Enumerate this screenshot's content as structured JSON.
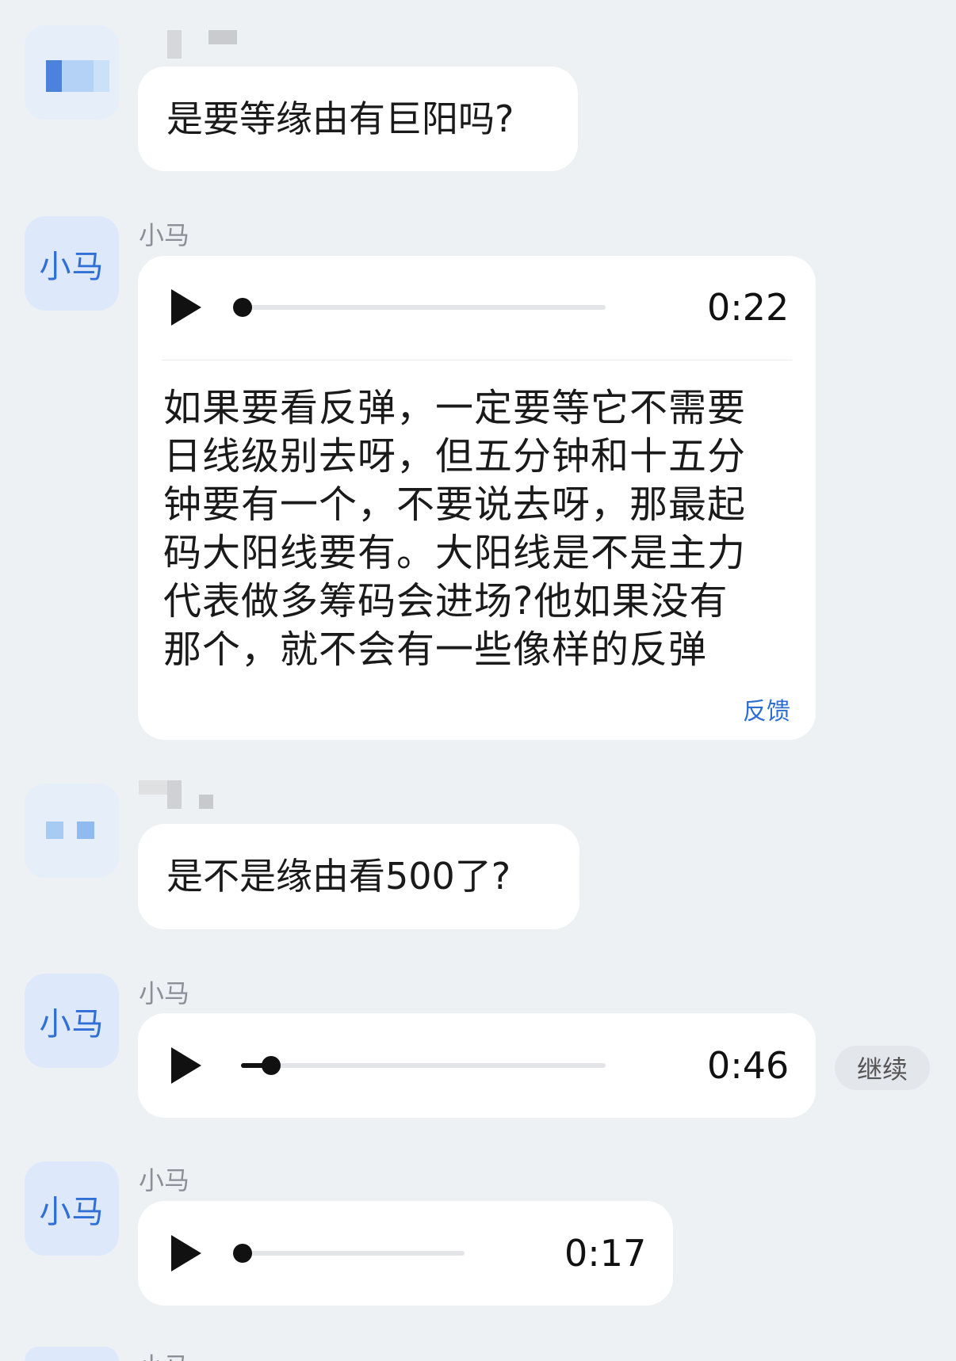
{
  "colors": {
    "background": "#eef1f4",
    "bubble": "#ffffff",
    "avatar_bg": "#dde9fb",
    "avatar_text": "#2f6fd6",
    "link": "#2d6fd1"
  },
  "messages": [
    {
      "type": "text",
      "sender_blurred": true,
      "text": "是要等缘由有巨阳吗?"
    },
    {
      "type": "voice",
      "avatar_label": "小马",
      "sender": "小马",
      "duration": "0:22",
      "progress": 0.0,
      "transcript_lines": [
        "如果要看反弹，一定要等它不需要",
        "日线级别去呀，但五分钟和十五分",
        "钟要有一个，不要说去呀，那最起",
        "码大阳线要有。大阳线是不是主力",
        "代表做多筹码会进场?他如果没有",
        "那个，就不会有一些像样的反弹"
      ],
      "feedback_label": "反馈"
    },
    {
      "type": "text",
      "sender_blurred": true,
      "text": "是不是缘由看500了?"
    },
    {
      "type": "voice",
      "avatar_label": "小马",
      "sender": "小马",
      "duration": "0:46",
      "progress": 0.07,
      "continue_label": "继续"
    },
    {
      "type": "voice",
      "avatar_label": "小马",
      "sender": "小马",
      "duration": "0:17",
      "progress": 0.0
    },
    {
      "type": "partial",
      "avatar_label": "小马",
      "sender": "小马"
    }
  ]
}
